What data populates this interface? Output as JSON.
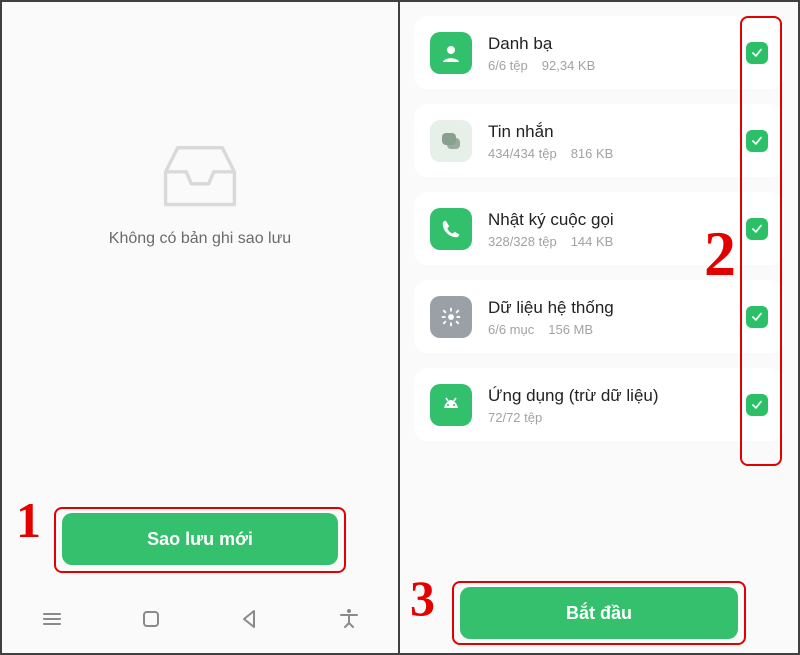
{
  "left": {
    "empty_text": "Không có bản ghi sao lưu",
    "primary_button": "Sao lưu mới"
  },
  "right": {
    "items": [
      {
        "title": "Danh bạ",
        "count": "6/6 tệp",
        "size": "92,34 KB",
        "icon": "contact",
        "icon_bg": "#33c06c",
        "icon_fg": "#fff"
      },
      {
        "title": "Tin nhắn",
        "count": "434/434 tệp",
        "size": "816 KB",
        "icon": "message",
        "icon_bg": "#e7efe9",
        "icon_fg": "#8aa08f"
      },
      {
        "title": "Nhật ký cuộc gọi",
        "count": "328/328 tệp",
        "size": "144 KB",
        "icon": "phone",
        "icon_bg": "#33c06c",
        "icon_fg": "#fff"
      },
      {
        "title": "Dữ liệu hệ thống",
        "count": "6/6 mục",
        "size": "156 MB",
        "icon": "gear",
        "icon_bg": "#9aa0a6",
        "icon_fg": "#fff"
      },
      {
        "title": "Ứng dụng (trừ dữ liệu)",
        "count": "72/72 tệp",
        "size": "",
        "icon": "android",
        "icon_bg": "#33c06c",
        "icon_fg": "#fff"
      }
    ],
    "start_button": "Bắt đầu"
  },
  "annotations": {
    "n1": "1",
    "n2": "2",
    "n3": "3"
  }
}
